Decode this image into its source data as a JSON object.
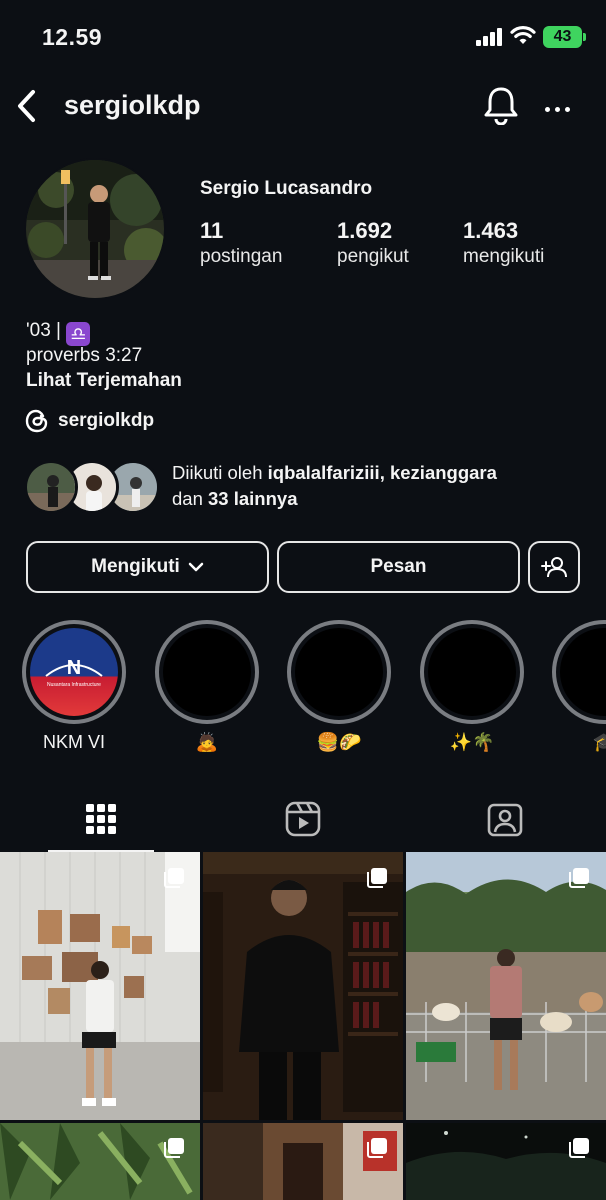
{
  "status_bar": {
    "time": "12.59",
    "battery": "43",
    "signal_icon": "cellular-signal-icon",
    "wifi_icon": "wifi-icon",
    "battery_color": "#3fd45f"
  },
  "header": {
    "username": "sergiolkdp",
    "back_icon": "chevron-left-icon",
    "bell_icon": "bell-icon",
    "more_icon": "more-horizontal-icon"
  },
  "profile": {
    "display_name": "Sergio Lucasandro",
    "stats": [
      {
        "value": "11",
        "label": "postingan"
      },
      {
        "value": "1.692",
        "label": "pengikut"
      },
      {
        "value": "1.463",
        "label": "mengikuti"
      }
    ],
    "bio": {
      "line1": "'03 |",
      "zodiac_symbol": "♎",
      "line2": "proverbs 3:27",
      "translate_link": "Lihat Terjemahan"
    },
    "threads_handle": "sergiolkdp",
    "followed_by": {
      "prefix": "Diikuti oleh",
      "users": "iqbalalfariziii, kezianggara",
      "middle": "dan",
      "others": "33 lainnya"
    }
  },
  "actions": {
    "following_label": "Mengikuti",
    "message_label": "Pesan",
    "add_user_icon": "add-user-icon"
  },
  "highlights": [
    {
      "label": "NKM VI",
      "cover_text": "Nusantara Infrastructure"
    },
    {
      "label": "🙇"
    },
    {
      "label": "🍔🌮"
    },
    {
      "label": "✨🌴"
    },
    {
      "label": "🎓"
    }
  ],
  "tabs": [
    {
      "name": "grid",
      "icon": "grid-icon",
      "active": true
    },
    {
      "name": "reels",
      "icon": "reels-icon",
      "active": false
    },
    {
      "name": "tagged",
      "icon": "tagged-person-icon",
      "active": false
    }
  ],
  "posts": [
    {
      "type": "carousel",
      "scene": "gallery-wall"
    },
    {
      "type": "carousel",
      "scene": "wine-room"
    },
    {
      "type": "carousel",
      "scene": "alpaca-park"
    },
    {
      "type": "carousel",
      "scene": "forest"
    },
    {
      "type": "carousel",
      "scene": "shop"
    },
    {
      "type": "carousel",
      "scene": "night"
    }
  ]
}
